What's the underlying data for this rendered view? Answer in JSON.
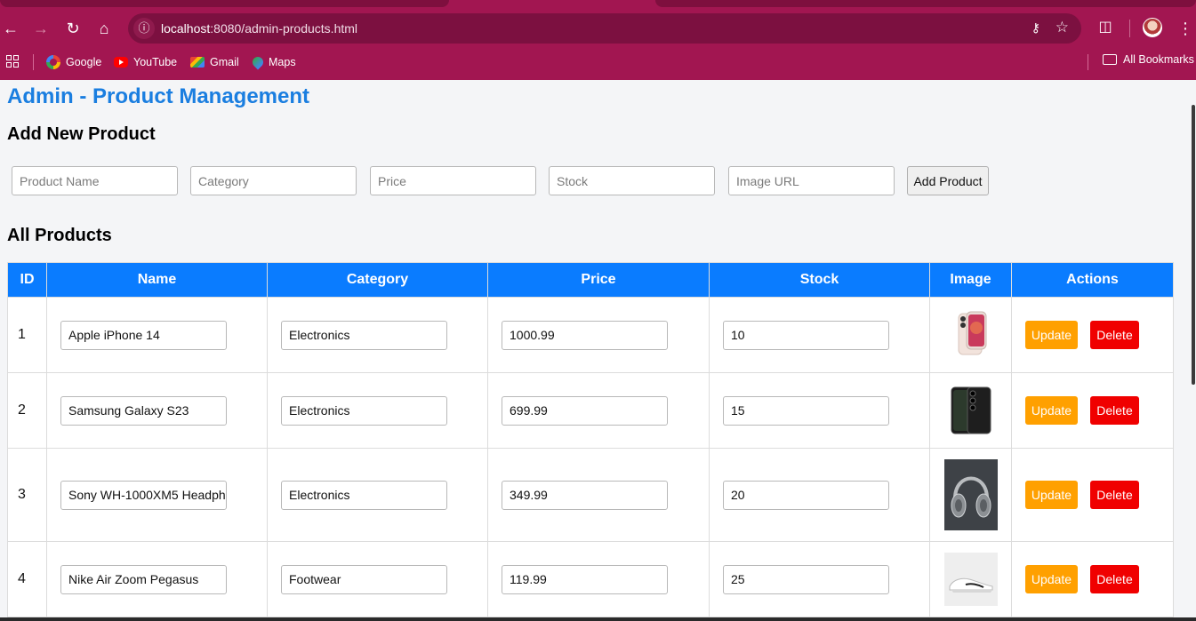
{
  "browser": {
    "url_host": "localhost",
    "url_rest": ":8080/admin-products.html",
    "bookmarks": [
      "Google",
      "YouTube",
      "Gmail",
      "Maps"
    ],
    "all_bookmarks": "All Bookmarks",
    "accent": "#a21651"
  },
  "page": {
    "title": "Admin - Product Management",
    "add_heading": "Add New Product",
    "list_heading": "All Products"
  },
  "form": {
    "name_placeholder": "Product Name",
    "category_placeholder": "Category",
    "price_placeholder": "Price",
    "stock_placeholder": "Stock",
    "image_placeholder": "Image URL",
    "add_label": "Add Product"
  },
  "table": {
    "headers": [
      "ID",
      "Name",
      "Category",
      "Price",
      "Stock",
      "Image",
      "Actions"
    ],
    "update_label": "Update",
    "delete_label": "Delete",
    "header_color": "#0a7cff",
    "rows": [
      {
        "id": "1",
        "name": "Apple iPhone 14",
        "category": "Electronics",
        "price": "1000.99",
        "stock": "10",
        "image_icon": "iphone-image"
      },
      {
        "id": "2",
        "name": "Samsung Galaxy S23",
        "category": "Electronics",
        "price": "699.99",
        "stock": "15",
        "image_icon": "galaxy-phone-image"
      },
      {
        "id": "3",
        "name": "Sony WH-1000XM5 Headph",
        "category": "Electronics",
        "price": "349.99",
        "stock": "20",
        "image_icon": "headphones-image"
      },
      {
        "id": "4",
        "name": "Nike Air Zoom Pegasus",
        "category": "Footwear",
        "price": "119.99",
        "stock": "25",
        "image_icon": "sneaker-image"
      }
    ]
  }
}
